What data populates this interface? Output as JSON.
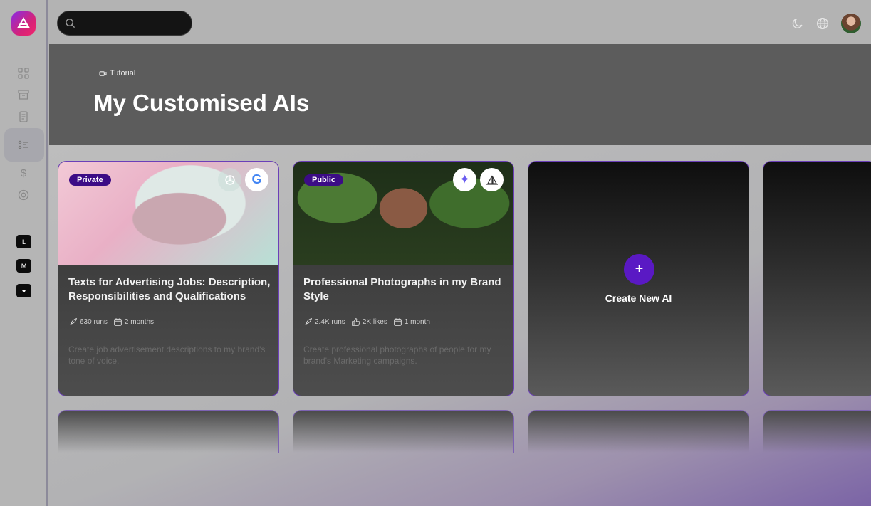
{
  "sidebar": {
    "logo": "brand-logo",
    "nav": [
      {
        "name": "dashboard-icon"
      },
      {
        "name": "archive-icon"
      },
      {
        "name": "document-icon"
      },
      {
        "name": "list-icon",
        "active": true
      },
      {
        "name": "dollar-icon"
      },
      {
        "name": "support-icon"
      }
    ],
    "workspaces": [
      "L",
      "M",
      "♥"
    ]
  },
  "topbar": {
    "search_placeholder": "",
    "icons": [
      "moon-icon",
      "globe-icon"
    ],
    "avatar": "user-avatar"
  },
  "hero": {
    "tutorial_label": "Tutorial",
    "title": "My Customised AIs"
  },
  "cards": [
    {
      "badge": "Private",
      "title": "Texts for Advertising Jobs: Description, Responsibilities and Qualifications",
      "runs": "630 runs",
      "age": "2 months",
      "description": "Create job advertisement descriptions to my brand's tone of voice."
    },
    {
      "badge": "Public",
      "title": "Professional Photographs in my Brand Style",
      "runs": "2.4K runs",
      "likes": "2K likes",
      "age": "1 month",
      "description": "Create professional photographs of people for my brand's Marketing campaigns."
    }
  ],
  "create": {
    "plus": "+",
    "label": "Create New AI"
  },
  "colors": {
    "accent": "#5a19c4",
    "badge": "#3c0c86",
    "card_border": "#6b3fb8"
  }
}
